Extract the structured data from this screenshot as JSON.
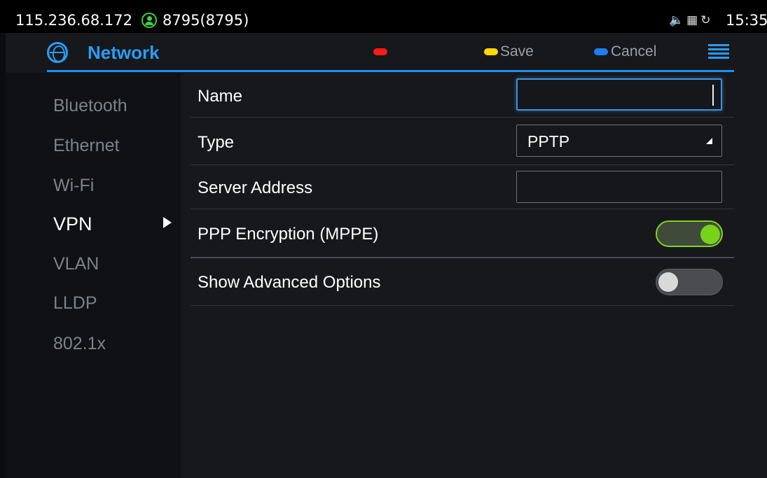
{
  "status_bar": {
    "ip": "115.236.68.172",
    "account": "8795(8795)",
    "icons": [
      "volume-icon",
      "sim-icon",
      "sync-icon"
    ],
    "time": "15:35"
  },
  "header": {
    "title": "Network",
    "softkeys": {
      "red": "",
      "yellow": "Save",
      "blue": "Cancel"
    },
    "accent_color": "#2a9df4"
  },
  "sidebar": {
    "items": [
      {
        "label": "Bluetooth",
        "active": false
      },
      {
        "label": "Ethernet",
        "active": false
      },
      {
        "label": "Wi-Fi",
        "active": false
      },
      {
        "label": "VPN",
        "active": true
      },
      {
        "label": "VLAN",
        "active": false
      },
      {
        "label": "LLDP",
        "active": false
      },
      {
        "label": "802.1x",
        "active": false
      }
    ]
  },
  "form": {
    "name": {
      "label": "Name",
      "value": ""
    },
    "type": {
      "label": "Type",
      "value": "PPTP"
    },
    "server_address": {
      "label": "Server Address",
      "value": ""
    },
    "ppp_encryption": {
      "label": "PPP Encryption (MPPE)",
      "enabled": true
    },
    "advanced_options": {
      "label": "Show Advanced Options",
      "enabled": false
    }
  }
}
